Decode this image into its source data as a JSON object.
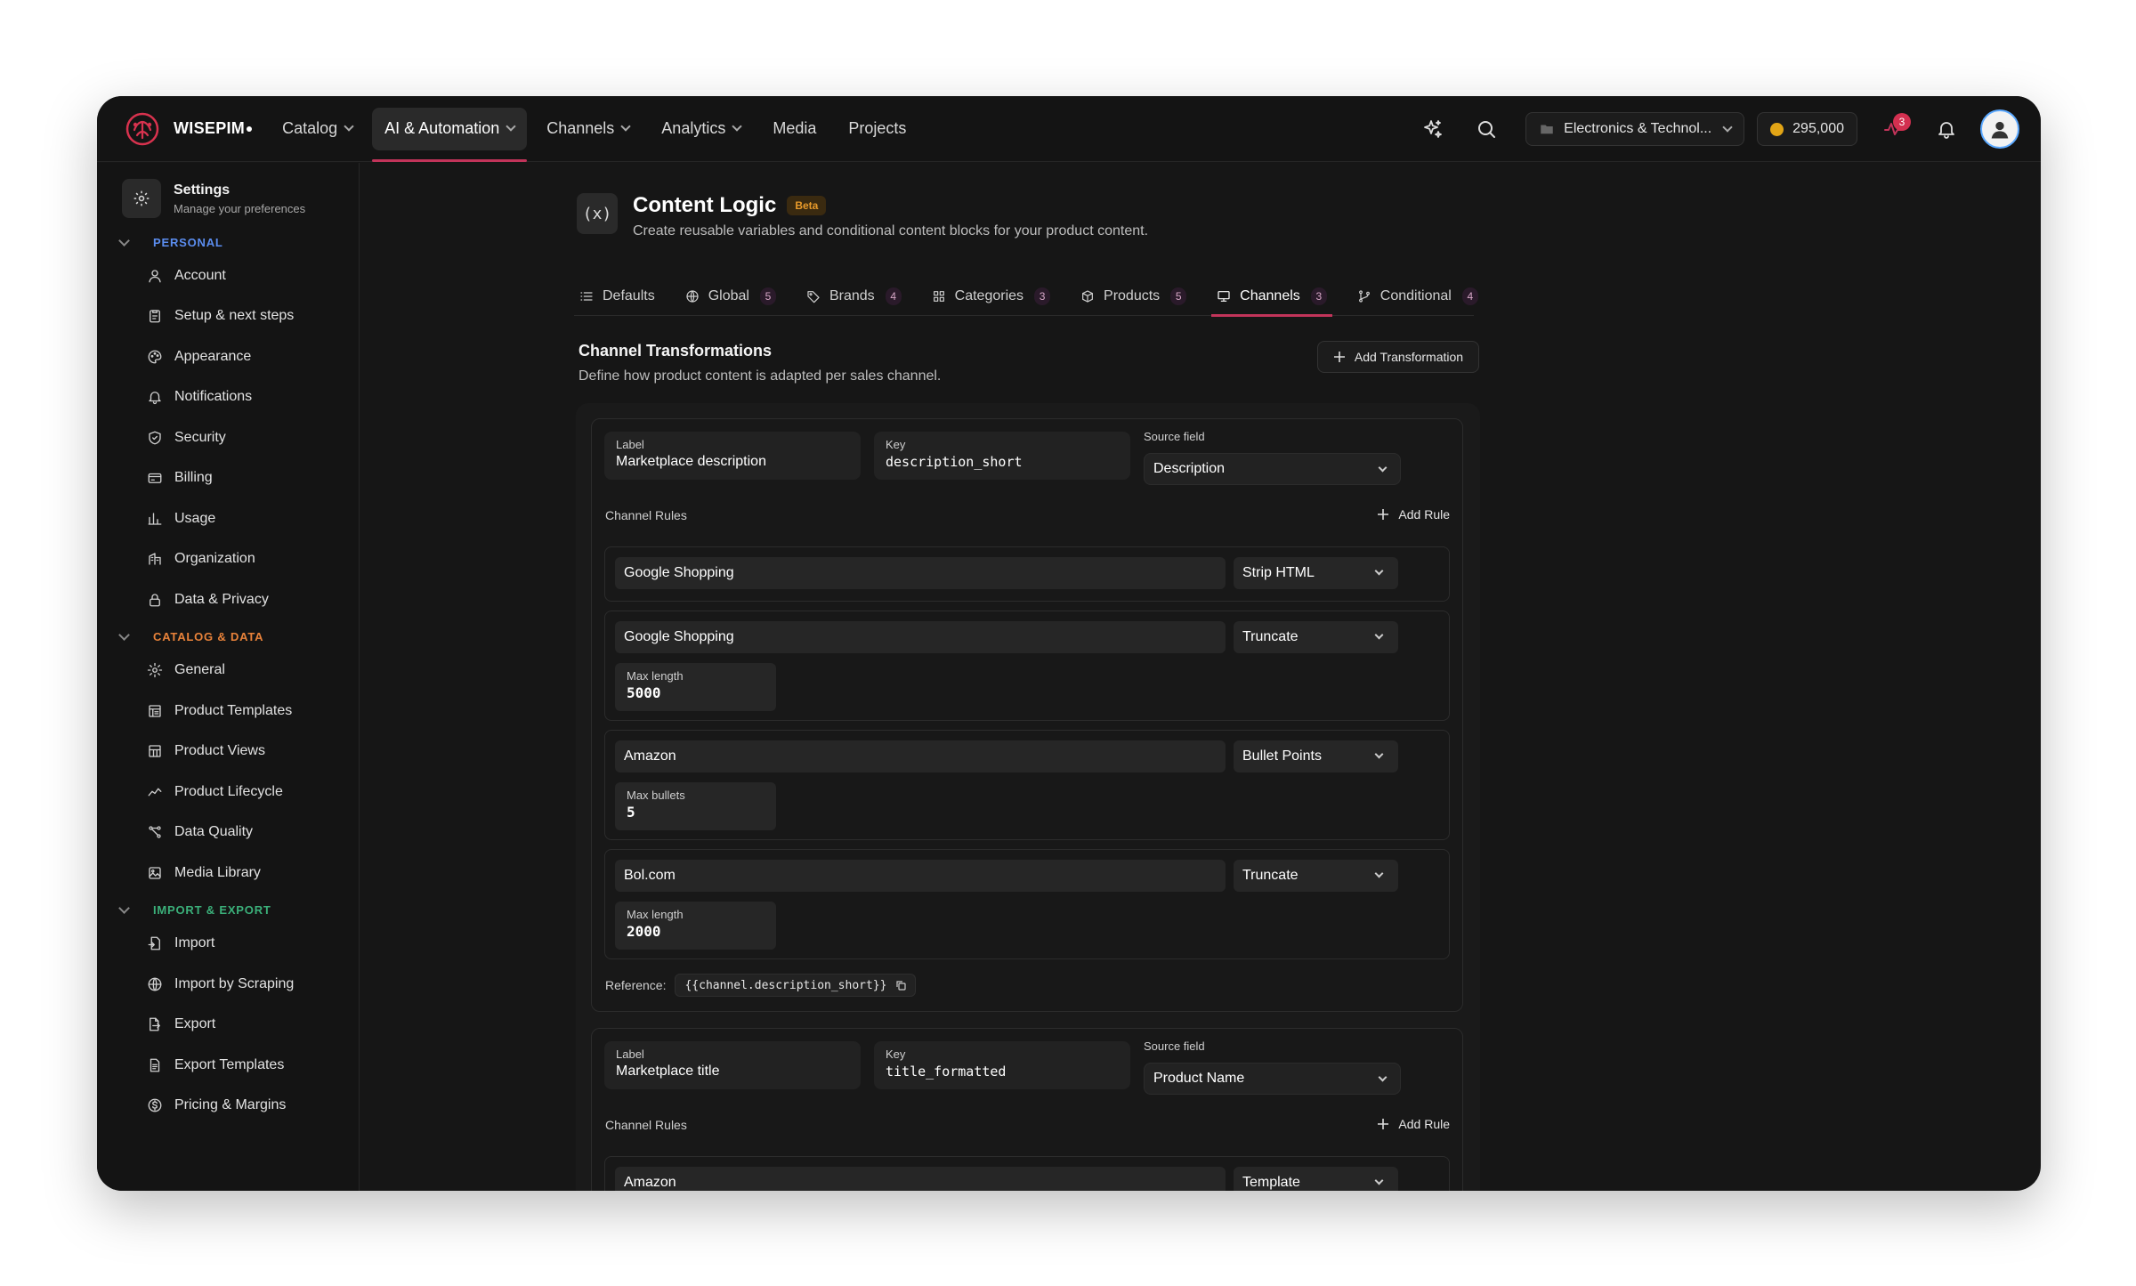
{
  "app": {
    "brand": "WISEPIM",
    "nav": [
      {
        "label": "Catalog",
        "has_menu": true
      },
      {
        "label": "AI & Automation",
        "has_menu": true,
        "active": true
      },
      {
        "label": "Channels",
        "has_menu": true
      },
      {
        "label": "Analytics",
        "has_menu": true
      },
      {
        "label": "Media",
        "has_menu": false
      },
      {
        "label": "Projects",
        "has_menu": false
      }
    ],
    "workspace": "Electronics & Technol...",
    "credits": "295,000",
    "notification_count": "3"
  },
  "sidebar": {
    "title": "Settings",
    "subtitle": "Manage your preferences",
    "sections": [
      {
        "label": "PERSONAL",
        "color": "#5b8def",
        "items": [
          {
            "label": "Account",
            "icon": "user-icon"
          },
          {
            "label": "Setup & next steps",
            "icon": "clipboard-icon"
          },
          {
            "label": "Appearance",
            "icon": "palette-icon"
          },
          {
            "label": "Notifications",
            "icon": "bell-icon"
          },
          {
            "label": "Security",
            "icon": "shield-icon"
          },
          {
            "label": "Billing",
            "icon": "credit-card-icon"
          },
          {
            "label": "Usage",
            "icon": "bar-chart-icon"
          },
          {
            "label": "Organization",
            "icon": "organization-icon"
          },
          {
            "label": "Data & Privacy",
            "icon": "lock-icon"
          }
        ]
      },
      {
        "label": "CATALOG & DATA",
        "color": "#e8823a",
        "items": [
          {
            "label": "General",
            "icon": "gear-icon"
          },
          {
            "label": "Product Templates",
            "icon": "template-icon"
          },
          {
            "label": "Product Views",
            "icon": "layout-icon"
          },
          {
            "label": "Product Lifecycle",
            "icon": "trend-icon"
          },
          {
            "label": "Data Quality",
            "icon": "quality-icon"
          },
          {
            "label": "Media Library",
            "icon": "image-icon"
          }
        ]
      },
      {
        "label": "IMPORT & EXPORT",
        "color": "#3bb07a",
        "items": [
          {
            "label": "Import",
            "icon": "file-import-icon"
          },
          {
            "label": "Import by Scraping",
            "icon": "globe-icon"
          },
          {
            "label": "Export",
            "icon": "file-export-icon"
          },
          {
            "label": "Export Templates",
            "icon": "file-template-icon"
          },
          {
            "label": "Pricing & Margins",
            "icon": "dollar-icon"
          }
        ]
      }
    ]
  },
  "page": {
    "icon_text": "(x)",
    "title": "Content Logic",
    "badge": "Beta",
    "description": "Create reusable variables and conditional content blocks for your product content.",
    "tabs": [
      {
        "label": "Defaults",
        "count": "",
        "icon": "list-icon"
      },
      {
        "label": "Global",
        "count": "5",
        "icon": "globe-icon"
      },
      {
        "label": "Brands",
        "count": "4",
        "icon": "tag-icon"
      },
      {
        "label": "Categories",
        "count": "3",
        "icon": "grid-icon"
      },
      {
        "label": "Products",
        "count": "5",
        "icon": "box-icon"
      },
      {
        "label": "Channels",
        "count": "3",
        "icon": "monitor-icon",
        "active": true
      },
      {
        "label": "Conditional",
        "count": "4",
        "icon": "branch-icon"
      }
    ],
    "section_title": "Channel Transformations",
    "section_desc": "Define how product content is adapted per sales channel.",
    "add_transformation": "Add Transformation"
  },
  "transformations": [
    {
      "label_caption": "Label",
      "label_value": "Marketplace description",
      "key_caption": "Key",
      "key_value": "description_short",
      "source_caption": "Source field",
      "source_value": "Description",
      "rules_caption": "Channel Rules",
      "add_rule": "Add Rule",
      "rules": [
        {
          "channel": "Google Shopping",
          "action": "Strip HTML"
        },
        {
          "channel": "Google Shopping",
          "action": "Truncate",
          "param_label": "Max length",
          "param_value": "5000"
        },
        {
          "channel": "Amazon",
          "action": "Bullet Points",
          "param_label": "Max bullets",
          "param_value": "5"
        },
        {
          "channel": "Bol.com",
          "action": "Truncate",
          "param_label": "Max length",
          "param_value": "2000"
        }
      ],
      "reference_caption": "Reference:",
      "reference_value": "{{channel.description_short}}"
    },
    {
      "label_caption": "Label",
      "label_value": "Marketplace title",
      "key_caption": "Key",
      "key_value": "title_formatted",
      "source_caption": "Source field",
      "source_value": "Product Name",
      "rules_caption": "Channel Rules",
      "add_rule": "Add Rule",
      "rules": [
        {
          "channel": "Amazon",
          "action": "Template"
        }
      ]
    }
  ]
}
